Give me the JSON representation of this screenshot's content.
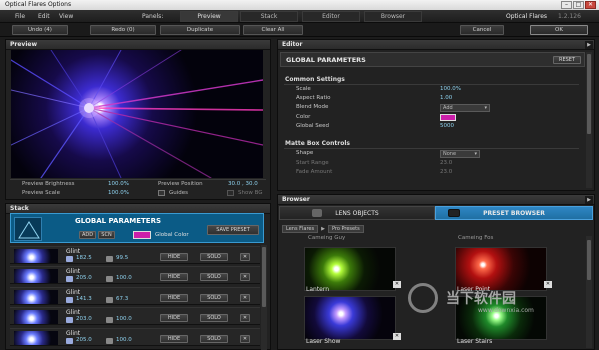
{
  "window": {
    "title": "Optical Flares Options",
    "min": "–",
    "max": "□",
    "close": "✕"
  },
  "menu": {
    "file": "File",
    "edit": "Edit",
    "view": "View",
    "panels_label": "Panels:",
    "version_name": "Optical Flares",
    "version": "1.2.126"
  },
  "panel_tabs": [
    "Preview",
    "Stack",
    "Editor",
    "Browser"
  ],
  "toolbar": {
    "undo": "Undo (4)",
    "redo": "Redo (0)",
    "duplicate": "Duplicate",
    "clear_all": "Clear All",
    "cancel": "Cancel",
    "ok": "OK"
  },
  "preview": {
    "header": "Preview",
    "brightness_label": "Preview Brightness",
    "brightness_value": "100.0%",
    "scale_label": "Preview Scale",
    "scale_value": "100.0%",
    "position_label": "Preview Position",
    "position_value": "30.0 , 30.0",
    "guides_label": "Guides",
    "showbg_label": "Show BG"
  },
  "stack": {
    "header": "Stack",
    "global_title": "GLOBAL PARAMETERS",
    "add": "ADD",
    "scn": "SCN",
    "global_color_label": "Global Color",
    "global_color": "#cc1faa",
    "save_preset": "SAVE PRESET",
    "rows": [
      {
        "name": "Glint",
        "brightness": "182.5",
        "scale": "99.5",
        "hide": "HIDE",
        "solo": "SOLO",
        "remove": "✕"
      },
      {
        "name": "Glint",
        "brightness": "205.0",
        "scale": "100.0",
        "hide": "HIDE",
        "solo": "SOLO",
        "remove": "✕"
      },
      {
        "name": "Glint",
        "brightness": "141.3",
        "scale": "67.3",
        "hide": "HIDE",
        "solo": "SOLO",
        "remove": "✕"
      },
      {
        "name": "Glint",
        "brightness": "203.0",
        "scale": "100.0",
        "hide": "HIDE",
        "solo": "SOLO",
        "remove": "✕"
      },
      {
        "name": "Glint",
        "brightness": "205.0",
        "scale": "100.0",
        "hide": "HIDE",
        "solo": "SOLO",
        "remove": "✕"
      }
    ]
  },
  "editor": {
    "header": "Editor",
    "title": "GLOBAL PARAMETERS",
    "reset": "RESET",
    "common_header": "Common Settings",
    "scale_label": "Scale",
    "scale_value": "100.0%",
    "aspect_label": "Aspect Ratio",
    "aspect_value": "1.00",
    "blend_label": "Blend Mode",
    "blend_value": "Add",
    "color_label": "Color",
    "color_value": "#cc1faa",
    "seed_label": "Global Seed",
    "seed_value": "5000",
    "matte_header": "Matte Box Controls",
    "shape_label": "Shape",
    "shape_value": "None",
    "start_label": "Start Range",
    "start_value": "23.0",
    "fade_label": "Fade Amount",
    "fade_value": "23.0"
  },
  "browser": {
    "header": "Browser",
    "tab_lens": "LENS OBJECTS",
    "tab_preset": "PRESET BROWSER",
    "crumb_root": "Lens Flares",
    "crumb_sub": "Pro Presets",
    "top_labels": [
      "Cameing Guy",
      "Cameing Fos"
    ],
    "tiles": [
      {
        "label": "Lantern"
      },
      {
        "label": "Laser Point"
      },
      {
        "label": "Laser Show"
      },
      {
        "label": "Laser Stairs"
      }
    ]
  },
  "watermark": {
    "cn": "当下软件园",
    "url": "www.downxia.com"
  },
  "colors": {
    "accent_blue": "#0b5b86",
    "active_tab": "#1f6fa3",
    "value_text": "#8fd3f0",
    "magenta": "#cc1faa"
  }
}
